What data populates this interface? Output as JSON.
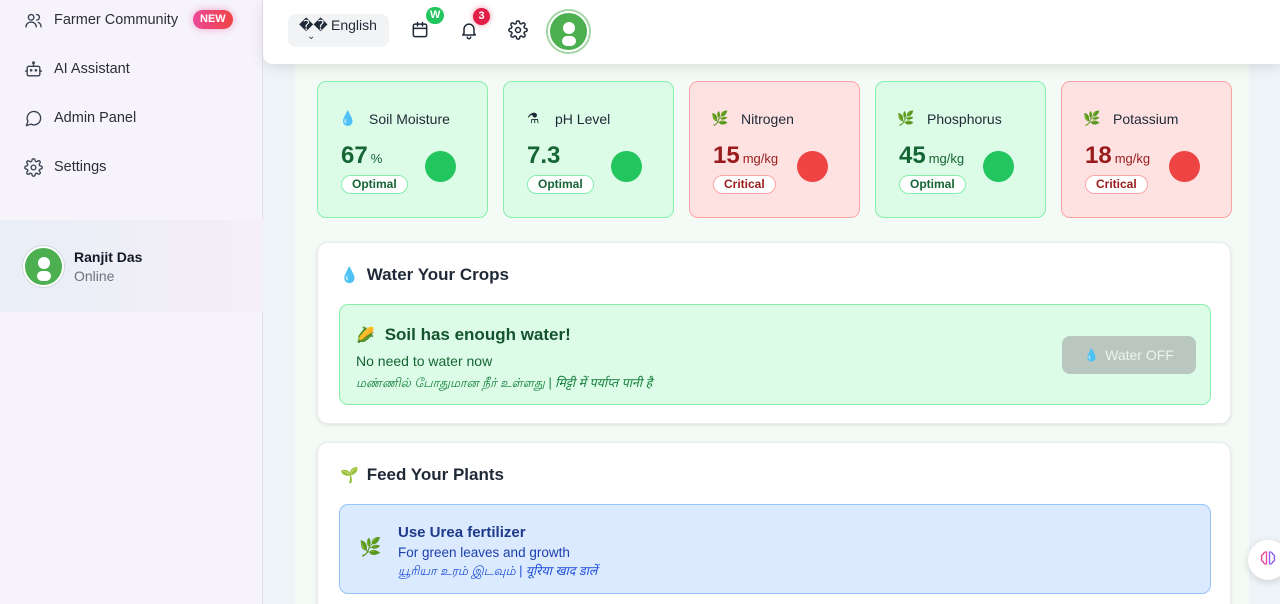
{
  "sidebar": {
    "items": [
      {
        "label": "Farmer Community",
        "icon": "users-icon"
      },
      {
        "label": "AI Assistant",
        "icon": "robot-icon"
      },
      {
        "label": "Admin Panel",
        "icon": "chat-bubble-icon"
      },
      {
        "label": "Settings",
        "icon": "gear-icon"
      }
    ],
    "new_badge": "NEW",
    "user": {
      "name": "Ranjit Das",
      "status": "Online"
    }
  },
  "topbar": {
    "language_glyph": "��",
    "language_chevron": "⌄",
    "language": "English",
    "calendar_badge": "W",
    "notification_count": "3"
  },
  "metrics": [
    {
      "title": "Soil Moisture",
      "icon": "droplet-icon",
      "emoji": "💧",
      "value": "67",
      "unit": "%",
      "status": "Optimal",
      "state": "ok"
    },
    {
      "title": "pH Level",
      "icon": "flask-icon",
      "emoji": "⚗",
      "value": "7.3",
      "unit": "",
      "status": "Optimal",
      "state": "ok"
    },
    {
      "title": "Nitrogen",
      "icon": "leaf-icon",
      "emoji": "🌿",
      "value": "15",
      "unit": "mg/kg",
      "status": "Critical",
      "state": "bad"
    },
    {
      "title": "Phosphorus",
      "icon": "leaf-icon",
      "emoji": "🌿",
      "value": "45",
      "unit": "mg/kg",
      "status": "Optimal",
      "state": "ok"
    },
    {
      "title": "Potassium",
      "icon": "leaf-icon",
      "emoji": "🌿",
      "value": "18",
      "unit": "mg/kg",
      "status": "Critical",
      "state": "bad"
    }
  ],
  "water": {
    "title_emoji": "💧",
    "title": "Water Your Crops",
    "box_emoji": "🌽",
    "box_title": "Soil has enough water!",
    "box_sub": "No need to water now",
    "box_translation": "மண்ணில் போதுமான நீர் உள்ளது | मिट्टी में पर्याप्त पानी है",
    "button_emoji": "💧",
    "button_label": "Water OFF"
  },
  "feed": {
    "title_emoji": "🌱",
    "title": "Feed Your Plants",
    "box_emoji": "🌿",
    "box_title": "Use Urea fertilizer",
    "box_sub": "For green leaves and growth",
    "box_translation": "யூரியா உரம் இடவும் | यूरिया खाद डालें"
  },
  "colors": {
    "ok_bg": "#dcfce7",
    "ok_border": "#86efac",
    "bad_bg": "#fee2e2",
    "bad_border": "#fca5a5",
    "ok_dot": "#22c55e",
    "bad_dot": "#ef4444"
  }
}
